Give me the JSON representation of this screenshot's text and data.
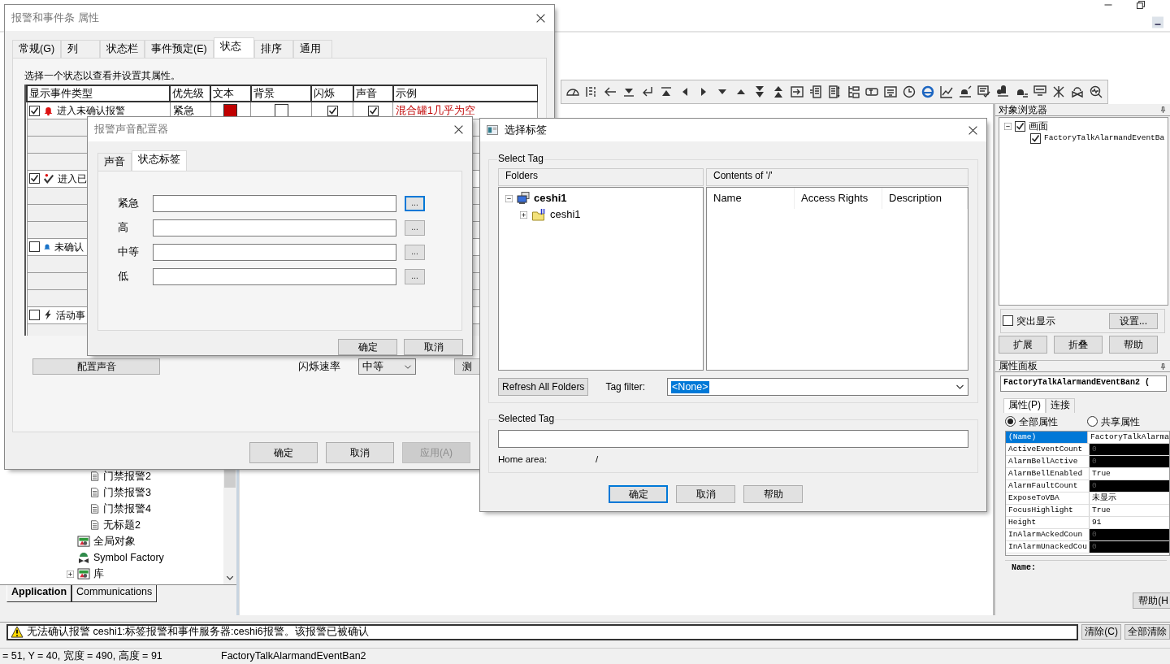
{
  "properties_dialog": {
    "title": "报警和事件条 属性",
    "tabs": [
      {
        "label": "常规(G)",
        "selected": false
      },
      {
        "label": "列",
        "selected": false
      },
      {
        "label": "状态栏",
        "selected": false
      },
      {
        "label": "事件预定(E)",
        "selected": false
      },
      {
        "label": "状态",
        "selected": true
      },
      {
        "label": "排序",
        "selected": false
      },
      {
        "label": "通用",
        "selected": false
      }
    ],
    "instruction": "选择一个状态以查看并设置其属性。",
    "columns": [
      "显示事件类型",
      "优先级",
      "文本",
      "背景",
      "闪烁",
      "声音",
      "示例"
    ],
    "rows": [
      {
        "kind": "state",
        "checked": true,
        "label": "进入未确认报警",
        "priority": "紧急",
        "text": {
          "color": "#c00000"
        },
        "background": {
          "color": "#ffffff"
        },
        "flash": true,
        "sound": true,
        "example": "混合罐1几乎为空"
      },
      {
        "kind": "blank"
      },
      {
        "kind": "blank"
      },
      {
        "kind": "blank"
      },
      {
        "kind": "state",
        "checked": true,
        "label": "进入已"
      },
      {
        "kind": "blank"
      },
      {
        "kind": "blank"
      },
      {
        "kind": "blank"
      },
      {
        "kind": "state",
        "checked": false,
        "label": "未确认"
      },
      {
        "kind": "blank"
      },
      {
        "kind": "blank"
      },
      {
        "kind": "blank"
      },
      {
        "kind": "state",
        "checked": false,
        "label": "活动事"
      },
      {
        "kind": "blank"
      }
    ],
    "sound_button": "配置声音",
    "flash_rate_label": "闪烁速率",
    "flash_rate": "中等",
    "test_button": "测",
    "buttons": [
      {
        "label": "确定",
        "disabled": false
      },
      {
        "label": "取消",
        "disabled": false
      },
      {
        "label": "应用(A)",
        "disabled": true
      }
    ]
  },
  "sound_dialog": {
    "title": "报警声音配置器",
    "tabs": [
      {
        "label": "声音",
        "selected": false
      },
      {
        "label": "状态标签",
        "selected": true
      }
    ],
    "fields": [
      {
        "label": "紧急",
        "focused": true
      },
      {
        "label": "高",
        "focused": false
      },
      {
        "label": "中等",
        "focused": false
      },
      {
        "label": "低",
        "focused": false
      }
    ],
    "browse_label": "...",
    "buttons": [
      "确定",
      "取消"
    ]
  },
  "select_tag_dialog": {
    "title": "选择标签",
    "group_label": "Select Tag",
    "folders_header": "Folders",
    "contents_header": "Contents of '/'",
    "tree": [
      {
        "label": "ceshi1",
        "expanded": true,
        "children": [
          {
            "label": "ceshi1",
            "expanded": false
          }
        ]
      }
    ],
    "columns": [
      "Name",
      "Access Rights",
      "Description"
    ],
    "refresh_button": "Refresh All Folders",
    "tag_filter_label": "Tag filter:",
    "tag_filter": "<None>",
    "selected_tag_label": "Selected Tag",
    "home_area_label": "Home area:",
    "home_area": "/",
    "buttons": [
      {
        "label": "确定",
        "default": true
      },
      {
        "label": "取消",
        "default": false
      },
      {
        "label": "帮助",
        "default": false
      }
    ]
  },
  "project_tree": {
    "items": [
      {
        "children": [
          {
            "label": "门禁报警2",
            "kind": "document"
          },
          {
            "label": "门禁报警3",
            "kind": "document"
          },
          {
            "label": "门禁报警4",
            "kind": "document"
          },
          {
            "label": "无标题2",
            "kind": "document"
          }
        ]
      },
      {
        "label": "全局对象",
        "kind": "graphic"
      },
      {
        "label": "Symbol Factory",
        "kind": "symbol"
      },
      {
        "label": "库",
        "kind": "graphic",
        "expanded": false
      }
    ],
    "tabs": [
      {
        "label": "Application",
        "selected": true
      },
      {
        "label": "Communications",
        "selected": false
      }
    ]
  },
  "object_browser": {
    "title": "对象浏览器",
    "tree": [
      {
        "label": "画面",
        "checked": true,
        "expanded": true,
        "children": [
          {
            "label": "FactoryTalkAlarmandEventBa",
            "checked": true
          }
        ]
      }
    ],
    "highlight": {
      "label": "突出显示",
      "checked": false
    },
    "settings_button": "设置...",
    "buttons": [
      "扩展",
      "折叠",
      "帮助"
    ]
  },
  "property_panel": {
    "title": "属性面板",
    "object_name": "FactoryTalkAlarmandEventBan2 (",
    "tabs": [
      {
        "label": "属性(P)",
        "selected": true
      },
      {
        "label": "连接",
        "selected": false
      }
    ],
    "radios": [
      {
        "label": "全部属性",
        "selected": true
      },
      {
        "label": "共享属性",
        "selected": false
      }
    ],
    "rows": [
      {
        "name": "(Name)",
        "value": "FactoryTalkAlarma",
        "selected": true,
        "readonly": false
      },
      {
        "name": "ActiveEventCount",
        "value": "0",
        "selected": false,
        "readonly": true
      },
      {
        "name": "AlarmBellActive",
        "value": "0",
        "selected": false,
        "readonly": true
      },
      {
        "name": "AlarmBellEnabled",
        "value": "True",
        "selected": false,
        "readonly": false
      },
      {
        "name": "AlarmFaultCount",
        "value": "0",
        "selected": false,
        "readonly": true
      },
      {
        "name": "ExposeToVBA",
        "value": "未显示",
        "selected": false,
        "readonly": false
      },
      {
        "name": "FocusHighlight",
        "value": "True",
        "selected": false,
        "readonly": false
      },
      {
        "name": "Height",
        "value": "91",
        "selected": false,
        "readonly": false
      },
      {
        "name": "InAlarmAckedCoun",
        "value": "0",
        "selected": false,
        "readonly": true
      },
      {
        "name": "InAlarmUnackedCou",
        "value": "0",
        "selected": false,
        "readonly": true
      }
    ],
    "description_title": "Name:",
    "help_button": "帮助(H"
  },
  "message_bar": {
    "text": "无法确认报警 ceshi1:标签报警和事件服务器:ceshi6报警。该报警已被确认",
    "buttons": [
      "清除(C)",
      "全部清除"
    ]
  },
  "status_bar": {
    "position": "= 51, Y = 40, 宽度 = 490, 高度 = 91",
    "object": "FactoryTalkAlarmandEventBan2"
  }
}
